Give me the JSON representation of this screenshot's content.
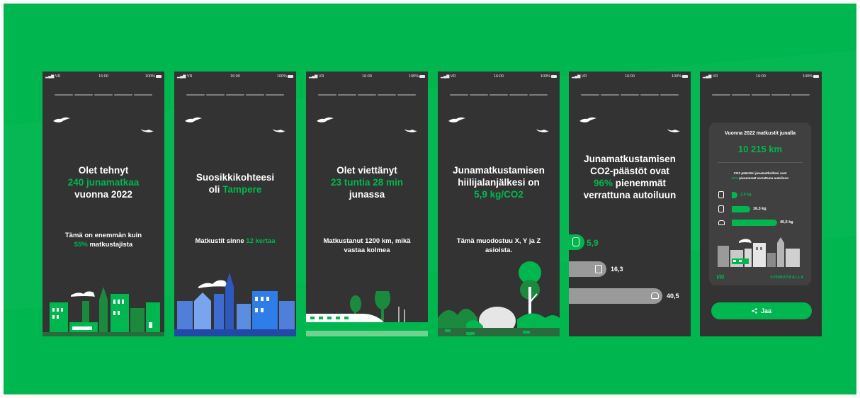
{
  "status_bar": {
    "carrier": "VR",
    "time": "16:00",
    "battery": "100%"
  },
  "screens": [
    {
      "headline": [
        "Olet tehnyt",
        "240 junamatkaa",
        "vuonna 2022"
      ],
      "sub": [
        "Tämä on enemmän kuin",
        "55%",
        " matkustajista"
      ]
    },
    {
      "headline": [
        "Suosikkikohteesi",
        "oli ",
        "Tampere"
      ],
      "sub": [
        "Matkustit sinne ",
        "12 kertaa"
      ]
    },
    {
      "headline": [
        "Olet viettänyt",
        "23 tuntia 28 min",
        "junassa"
      ],
      "sub": [
        "Matkustanut 1200 km, mikä",
        "vastaa kolmea"
      ]
    },
    {
      "headline": [
        "Junamatkustamisen",
        "hiilijalanjälkesi on",
        "5,9 kg/CO2"
      ],
      "sub": [
        "Tämä muodostuu X, Y ja Z",
        "asioista."
      ]
    },
    {
      "headline": [
        "Junamatkustamisen",
        "CO2-päästöt ovat",
        "96%",
        " pienemmät",
        "verrattuna autoiluun"
      ],
      "bars": [
        {
          "icon": "train-icon",
          "value": "5,9",
          "amount": 5.9
        },
        {
          "icon": "bus-icon",
          "value": "16,3",
          "amount": 16.3
        },
        {
          "icon": "car-icon",
          "value": "40,5",
          "amount": 40.5
        }
      ]
    },
    {
      "card_title": "Vuonna 2022 matkustit junalla",
      "card_distance": "10 215 km",
      "card_note_1": "CO2 päästösi junamatkoiltasi ovat",
      "card_note_2_green": "96%",
      "card_note_2": " pienemmät verrattuna autoiluun",
      "bars": [
        {
          "icon": "train-icon",
          "value": "2,9 kg",
          "amount": 2.9
        },
        {
          "icon": "bus-icon",
          "value": "16,3 kg",
          "amount": 16.3
        },
        {
          "icon": "car-icon",
          "value": "40,5 kg",
          "amount": 40.5
        }
      ],
      "brand": "VR",
      "hashtag": "#VRMATKALLA",
      "share_label": "Jaa"
    }
  ],
  "colors": {
    "accent": "#00b74f",
    "background": "#00b74f",
    "phone": "#333333",
    "card": "#404040",
    "bar_grey": "#9a9a9a"
  }
}
